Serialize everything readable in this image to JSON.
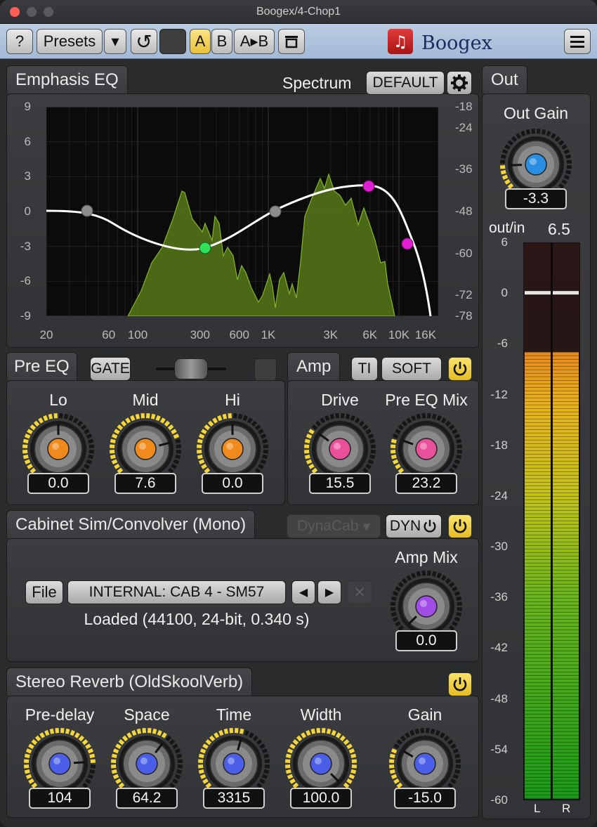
{
  "window": {
    "title": "Boogex/4-Chop1"
  },
  "toolbar": {
    "help_label": "?",
    "presets_label": "Presets",
    "dropdown_glyph": "▾",
    "undo_glyph": "↺",
    "a_label": "A",
    "b_label": "B",
    "ab_label": "A▸B",
    "brand_name": "Boogex",
    "logo_glyph": "♫"
  },
  "eq": {
    "tab_label": "Emphasis EQ",
    "spectrum_label": "Spectrum",
    "default_button": "DEFAULT",
    "left_ticks": [
      "9",
      "6",
      "3",
      "0",
      "-3",
      "-6",
      "-9"
    ],
    "right_ticks": [
      "-18",
      "-24",
      "-36",
      "-48",
      "-60",
      "-72",
      "-78"
    ],
    "freq_ticks": [
      "20",
      "60",
      "100",
      "300",
      "600",
      "1K",
      "3K",
      "6K",
      "10K",
      "16K"
    ],
    "accent_curve": "#ffffff",
    "accent_spectrum": "#6f9a1f"
  },
  "pre_eq": {
    "tab_label": "Pre EQ",
    "gate_label": "GATE",
    "knobs": [
      {
        "label": "Lo",
        "value": "0.0",
        "level": 0.5,
        "color": "#f08a1c"
      },
      {
        "label": "Mid",
        "value": "7.6",
        "level": 0.78,
        "color": "#f08a1c"
      },
      {
        "label": "Hi",
        "value": "0.0",
        "level": 0.5,
        "color": "#f08a1c"
      }
    ]
  },
  "amp": {
    "tab_label": "Amp",
    "ti_label": "TI",
    "soft_label": "SOFT",
    "knobs": [
      {
        "label": "Drive",
        "value": "15.5",
        "level": 0.3,
        "color": "#e8509a"
      },
      {
        "label": "Pre EQ Mix",
        "value": "23.2",
        "level": 0.24,
        "color": "#e8509a"
      }
    ]
  },
  "cab": {
    "tab_label": "Cabinet Sim/Convolver (Mono)",
    "dyncab_label": "DynaCab",
    "dyn_label": "DYN",
    "amp_mix_label": "Amp Mix",
    "amp_mix_value": "0.0",
    "amp_mix_level": 0.0,
    "file_label": "File",
    "ir_name": "INTERNAL: CAB 4 - SM57",
    "prev_glyph": "◀",
    "next_glyph": "▶",
    "clear_glyph": "✕",
    "loaded_info": "Loaded (44100, 24-bit, 0.340 s)"
  },
  "reverb": {
    "tab_label": "Stereo Reverb (OldSkoolVerb)",
    "knobs": [
      {
        "label": "Pre-delay",
        "value": "104",
        "level": 0.82,
        "color": "#4a5ee8"
      },
      {
        "label": "Space",
        "value": "64.2",
        "level": 0.64,
        "color": "#4a5ee8"
      },
      {
        "label": "Time",
        "value": "3315",
        "level": 0.56,
        "color": "#4a5ee8"
      },
      {
        "label": "Width",
        "value": "100.0",
        "level": 1.0,
        "color": "#4a5ee8"
      },
      {
        "label": "Gain",
        "value": "-15.0",
        "level": 0.28,
        "color": "#4a5ee8"
      }
    ]
  },
  "out": {
    "tab_label": "Out",
    "gain_label": "Out Gain",
    "gain_value": "-3.3",
    "gain_level": 0.16,
    "gain_color": "#2a8fe0",
    "outin_label": "out/in",
    "outin_value": "6.5",
    "scale": [
      "6",
      "0",
      "-6",
      "-12",
      "-18",
      "-24",
      "-30",
      "-36",
      "-42",
      "-48",
      "-54",
      "-60"
    ],
    "channel_l": "L",
    "channel_r": "R",
    "meter_level_db": -7,
    "peak_db": 0
  }
}
